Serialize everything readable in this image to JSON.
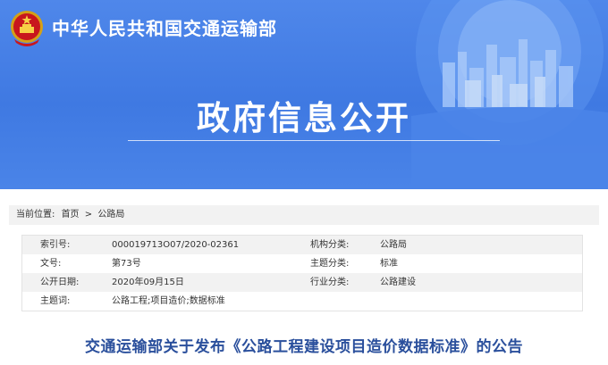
{
  "header": {
    "ministry_name": "中华人民共和国交通运输部",
    "main_title": "政府信息公开",
    "emblem_icon": "national-emblem-icon",
    "colors": {
      "banner_blue": "#4a84e8",
      "title_blue": "#2a4f9c"
    }
  },
  "breadcrumb": {
    "label": "当前位置:",
    "home": "首页",
    "separator": ">",
    "current": "公路局"
  },
  "meta": {
    "rows": [
      {
        "label1": "索引号:",
        "value1": "000019713O07/2020-02361",
        "label2": "机构分类:",
        "value2": "公路局"
      },
      {
        "label1": "文号:",
        "value1": "第73号",
        "label2": "主题分类:",
        "value2": "标准"
      },
      {
        "label1": "公开日期:",
        "value1": "2020年09月15日",
        "label2": "行业分类:",
        "value2": "公路建设"
      },
      {
        "label1": "主题词:",
        "value1": "公路工程;项目造价;数据标准"
      }
    ]
  },
  "document": {
    "title": "交通运输部关于发布《公路工程建设项目造价数据标准》的公告"
  }
}
